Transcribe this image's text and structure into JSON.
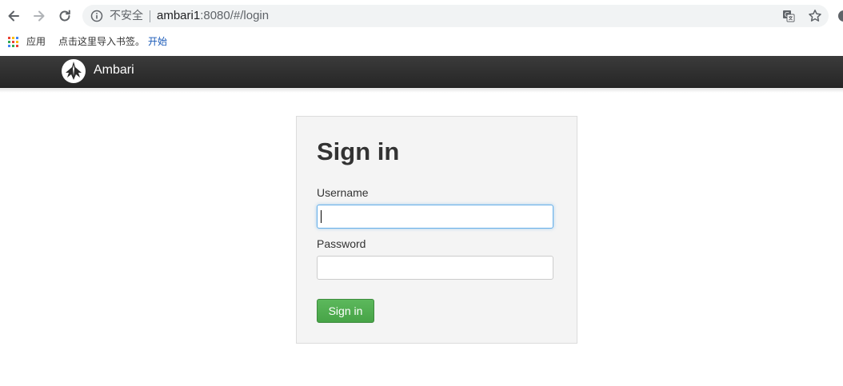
{
  "browser": {
    "security_label": "不安全",
    "url_host": "ambari1",
    "url_path": ":8080/#/login",
    "icons": {
      "back": "back-arrow-icon",
      "forward": "forward-arrow-icon",
      "reload": "reload-icon",
      "info": "info-icon",
      "translate": "translate-icon",
      "star": "star-icon",
      "apps": "apps-grid-icon"
    }
  },
  "bookmarks": {
    "apps_label": "应用",
    "hint": "点击这里导入书签。",
    "start_link": "开始"
  },
  "navbar": {
    "app_name": "Ambari",
    "logo_icon": "ambari-logo-icon"
  },
  "login": {
    "title": "Sign in",
    "username_label": "Username",
    "username_value": "",
    "password_label": "Password",
    "password_value": "",
    "submit_label": "Sign in"
  },
  "colors": {
    "navbar_bg": "#2b2b2b",
    "panel_bg": "#f4f4f4",
    "button_green": "#51ad51",
    "focus_blue": "#66afe9",
    "link_blue": "#1a5ab8"
  }
}
